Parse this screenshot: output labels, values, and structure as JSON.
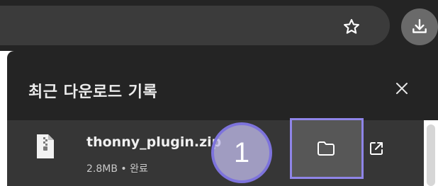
{
  "toolbar": {
    "star_icon": "star-outline-icon",
    "download_icon": "download-icon"
  },
  "downloads_panel": {
    "title": "최근 다운로드 기록",
    "close_icon": "close-icon",
    "items": [
      {
        "file_name": "thonny_plugin.zip",
        "size": "2.8MB",
        "separator": "•",
        "status": "완료",
        "file_icon": "zip-file-icon",
        "open_folder_icon": "folder-icon",
        "open_external_icon": "open-external-icon"
      }
    ]
  },
  "annotation": {
    "step_number": "1"
  },
  "colors": {
    "panel_bg": "#242424",
    "row_bg": "#363636",
    "highlight_outline": "#8f85e8",
    "marker_fill": "#beb8e8"
  }
}
